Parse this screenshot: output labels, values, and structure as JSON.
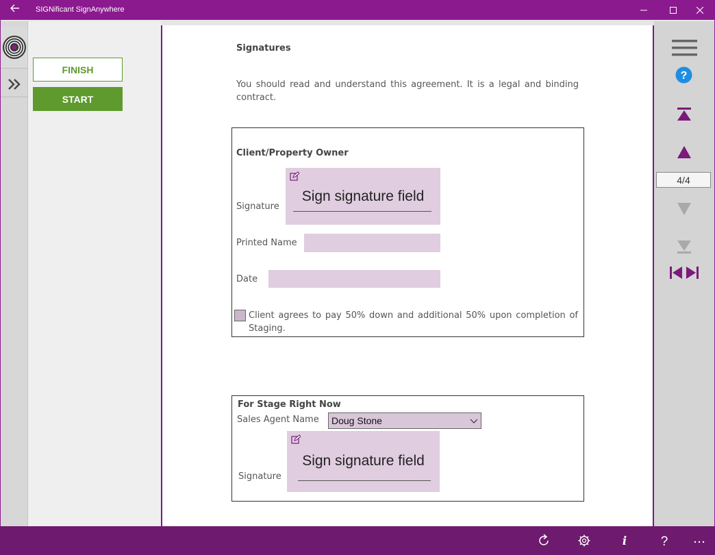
{
  "window": {
    "title": "SIGNificant SignAnywhere"
  },
  "sidebar": {
    "finish_label": "FINISH",
    "start_label": "START"
  },
  "document": {
    "heading": "Signatures",
    "intro": "You should read and understand this agreement. It is a legal and binding contract.",
    "client_section": {
      "heading": "Client/Property Owner",
      "signature_label": "Signature",
      "signature_placeholder": "Sign signature field",
      "printed_name_label": "Printed Name",
      "printed_name_value": "",
      "date_label": "Date",
      "date_value": "",
      "agreement_text": "Client agrees to pay 50% down and additional 50% upon completion of Staging.",
      "agreement_checked": false
    },
    "agent_section": {
      "heading": "For Stage Right Now",
      "agent_label": "Sales Agent Name",
      "agent_value": "Doug Stone",
      "signature_label": "Signature",
      "signature_placeholder": "Sign signature field"
    }
  },
  "navigation": {
    "page_indicator": "4/4"
  },
  "colors": {
    "titlebar": "#8b1a8f",
    "bottombar": "#6e1a6e",
    "accent_green": "#5e9a2e",
    "field_fill": "#e0cde0",
    "nav_purple": "#7a1a7a"
  },
  "icons": [
    "back-arrow-icon",
    "minimize-icon",
    "maximize-icon",
    "close-icon",
    "target-logo-icon",
    "double-chevron-right-icon",
    "hamburger-menu-icon",
    "help-circle-icon",
    "first-page-icon",
    "previous-page-icon",
    "next-page-icon",
    "last-page-icon",
    "previous-field-icon",
    "next-field-icon",
    "refresh-icon",
    "settings-gear-icon",
    "info-icon",
    "question-icon",
    "more-icon"
  ]
}
